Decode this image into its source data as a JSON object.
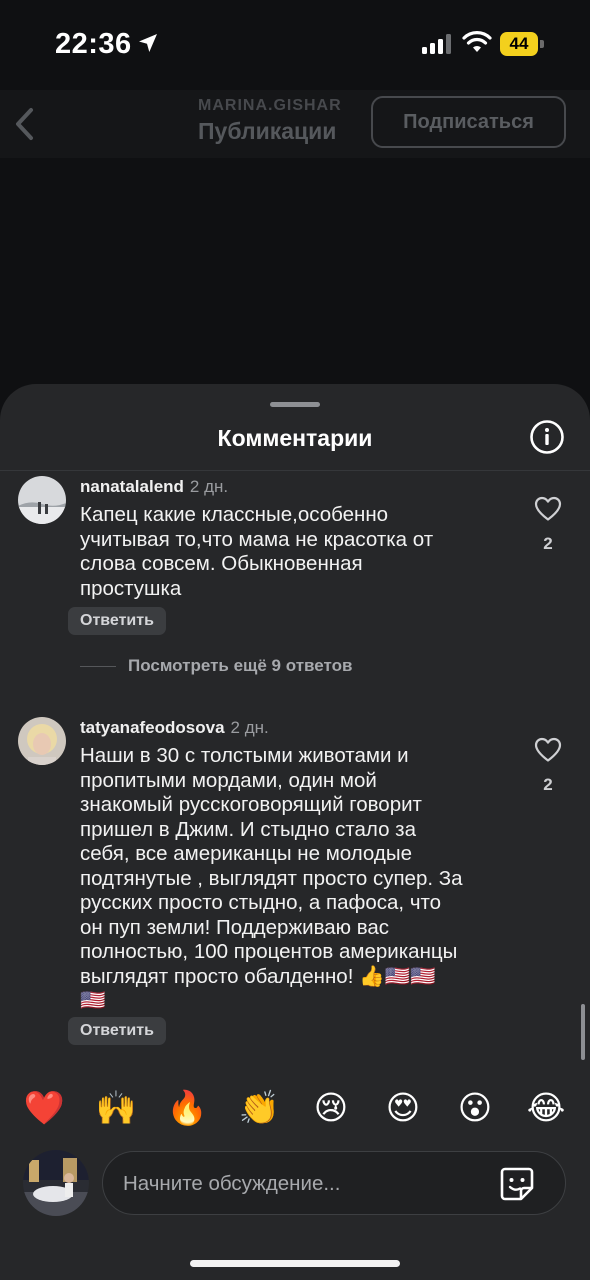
{
  "status_bar": {
    "time": "22:36",
    "battery_level": "44",
    "icons": [
      "location-arrow-icon",
      "signal-icon",
      "wifi-icon",
      "battery-icon"
    ]
  },
  "header": {
    "username": "MARINA.GISHAR",
    "title": "Публикации",
    "subscribe_label": "Подписаться",
    "back_icon": "chevron-left-icon"
  },
  "sheet": {
    "title": "Комментарии",
    "info_icon": "info-icon"
  },
  "comments": [
    {
      "author": "nanatalalend",
      "date": "2 дн.",
      "text_lines": [
        "Капец какие классные,особенно",
        "учитывая то,что мама не красотка от",
        "слова совсем. Обыкновенная",
        "простушка"
      ],
      "likes": "2",
      "reply_label": "Ответить"
    },
    {
      "author": "tatyanafeodosova",
      "date": "2 дн.",
      "text_lines": [
        "Наши в 30 с толстыми животами и",
        "пропитыми мордами, один мой",
        "знакомый русскоговорящий говорит",
        "пришел в Джим. И стыдно стало за",
        "себя, все американцы не молодые",
        "подтянутые , выглядят просто супер. За",
        "русских просто стыдно, а пафоса, что",
        "он пуп земли! Поддерживаю вас",
        "полностью, 100 процентов американцы",
        "выглядят просто обалденно! 👍🇺🇸🇺🇸",
        "🇺🇸"
      ],
      "likes": "2",
      "reply_label": "Ответить"
    }
  ],
  "more_replies_label": "Посмотреть ещё 9 ответов",
  "emoji_reactions": [
    "❤️",
    "🙌",
    "🔥",
    "👏",
    "😢",
    "😍",
    "😮",
    "😂"
  ],
  "composer": {
    "placeholder": "Начните обсуждение...",
    "sticker_icon": "sticker-icon"
  },
  "colors": {
    "background": "#0f1012",
    "sheet": "#262729",
    "battery": "#f3d01d",
    "text": "#ffffff",
    "muted": "#9a9ca0"
  }
}
